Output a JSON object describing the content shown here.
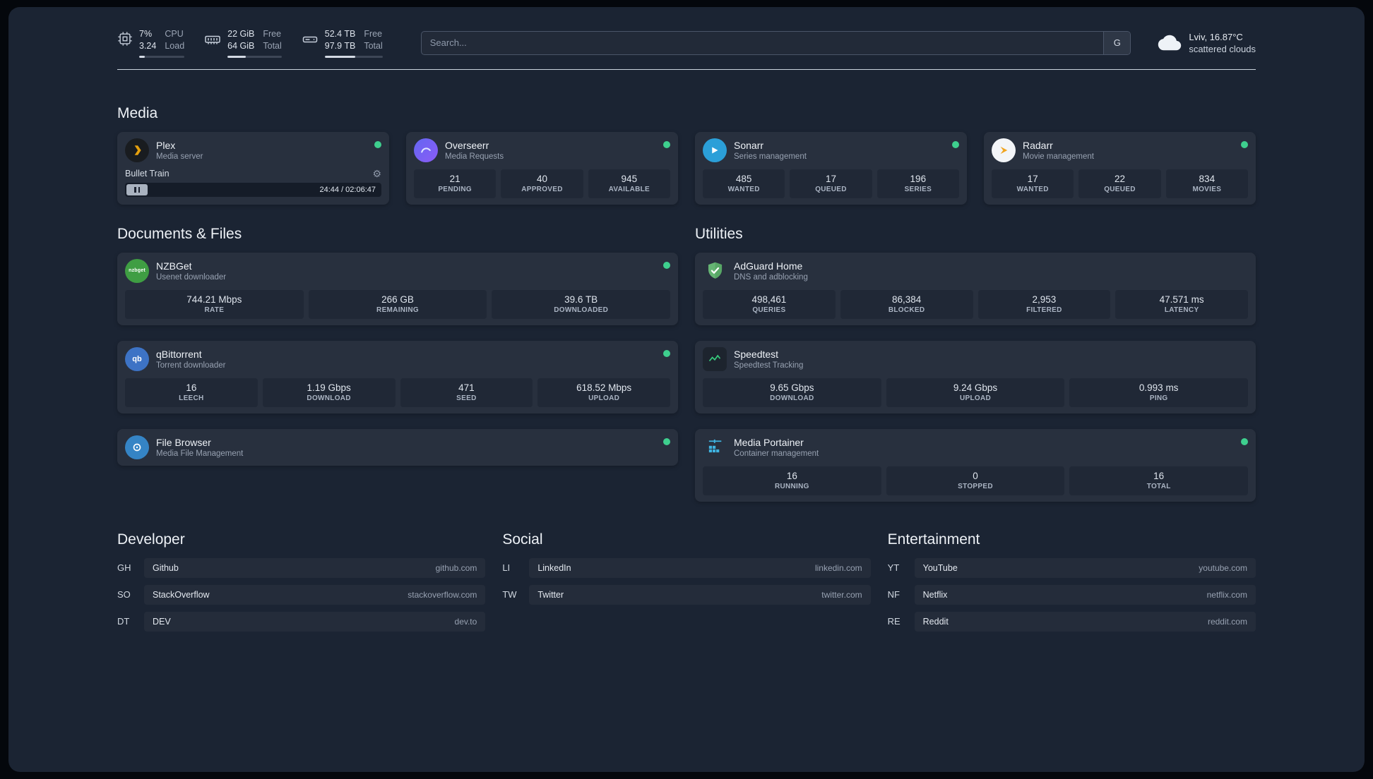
{
  "topbar": {
    "resources": [
      {
        "value1": "7%",
        "value2": "3.24",
        "label1": "CPU",
        "label2": "Load",
        "progress": 13
      },
      {
        "value1": "22 GiB",
        "value2": "64 GiB",
        "label1": "Free",
        "label2": "Total",
        "progress": 34
      },
      {
        "value1": "52.4 TB",
        "value2": "97.9 TB",
        "label1": "Free",
        "label2": "Total",
        "progress": 53
      }
    ],
    "search": {
      "placeholder": "Search...",
      "button_label": "G"
    },
    "weather": {
      "location": "Lviv, 16.87°C",
      "condition": "scattered clouds"
    }
  },
  "section_titles": {
    "media": "Media",
    "documents": "Documents & Files",
    "utilities": "Utilities",
    "developer": "Developer",
    "social": "Social",
    "entertainment": "Entertainment"
  },
  "services": {
    "plex": {
      "title": "Plex",
      "subtitle": "Media server",
      "now_playing": "Bullet Train",
      "time": "24:44 / 02:06:47"
    },
    "overseerr": {
      "title": "Overseerr",
      "subtitle": "Media Requests",
      "stats": [
        {
          "value": "21",
          "label": "PENDING"
        },
        {
          "value": "40",
          "label": "APPROVED"
        },
        {
          "value": "945",
          "label": "AVAILABLE"
        }
      ]
    },
    "sonarr": {
      "title": "Sonarr",
      "subtitle": "Series management",
      "stats": [
        {
          "value": "485",
          "label": "WANTED"
        },
        {
          "value": "17",
          "label": "QUEUED"
        },
        {
          "value": "196",
          "label": "SERIES"
        }
      ]
    },
    "radarr": {
      "title": "Radarr",
      "subtitle": "Movie management",
      "stats": [
        {
          "value": "17",
          "label": "WANTED"
        },
        {
          "value": "22",
          "label": "QUEUED"
        },
        {
          "value": "834",
          "label": "MOVIES"
        }
      ]
    },
    "nzbget": {
      "title": "NZBGet",
      "subtitle": "Usenet downloader",
      "icon_text": "nzbget",
      "stats": [
        {
          "value": "744.21 Mbps",
          "label": "RATE"
        },
        {
          "value": "266 GB",
          "label": "REMAINING"
        },
        {
          "value": "39.6 TB",
          "label": "DOWNLOADED"
        }
      ]
    },
    "qbittorrent": {
      "title": "qBittorrent",
      "subtitle": "Torrent downloader",
      "icon_text": "qb",
      "stats": [
        {
          "value": "16",
          "label": "LEECH"
        },
        {
          "value": "1.19 Gbps",
          "label": "DOWNLOAD"
        },
        {
          "value": "471",
          "label": "SEED"
        },
        {
          "value": "618.52 Mbps",
          "label": "UPLOAD"
        }
      ]
    },
    "filebrowser": {
      "title": "File Browser",
      "subtitle": "Media File Management"
    },
    "adguard": {
      "title": "AdGuard Home",
      "subtitle": "DNS and adblocking",
      "stats": [
        {
          "value": "498,461",
          "label": "QUERIES"
        },
        {
          "value": "86,384",
          "label": "BLOCKED"
        },
        {
          "value": "2,953",
          "label": "FILTERED"
        },
        {
          "value": "47.571 ms",
          "label": "LATENCY"
        }
      ]
    },
    "speedtest": {
      "title": "Speedtest",
      "subtitle": "Speedtest Tracking",
      "stats": [
        {
          "value": "9.65 Gbps",
          "label": "DOWNLOAD"
        },
        {
          "value": "9.24 Gbps",
          "label": "UPLOAD"
        },
        {
          "value": "0.993 ms",
          "label": "PING"
        }
      ]
    },
    "portainer": {
      "title": "Media Portainer",
      "subtitle": "Container management",
      "stats": [
        {
          "value": "16",
          "label": "RUNNING"
        },
        {
          "value": "0",
          "label": "STOPPED"
        },
        {
          "value": "16",
          "label": "TOTAL"
        }
      ]
    }
  },
  "bookmarks": {
    "developer": [
      {
        "abbr": "GH",
        "name": "Github",
        "domain": "github.com"
      },
      {
        "abbr": "SO",
        "name": "StackOverflow",
        "domain": "stackoverflow.com"
      },
      {
        "abbr": "DT",
        "name": "DEV",
        "domain": "dev.to"
      }
    ],
    "social": [
      {
        "abbr": "LI",
        "name": "LinkedIn",
        "domain": "linkedin.com"
      },
      {
        "abbr": "TW",
        "name": "Twitter",
        "domain": "twitter.com"
      }
    ],
    "entertainment": [
      {
        "abbr": "YT",
        "name": "YouTube",
        "domain": "youtube.com"
      },
      {
        "abbr": "NF",
        "name": "Netflix",
        "domain": "netflix.com"
      },
      {
        "abbr": "RE",
        "name": "Reddit",
        "domain": "reddit.com"
      }
    ]
  }
}
